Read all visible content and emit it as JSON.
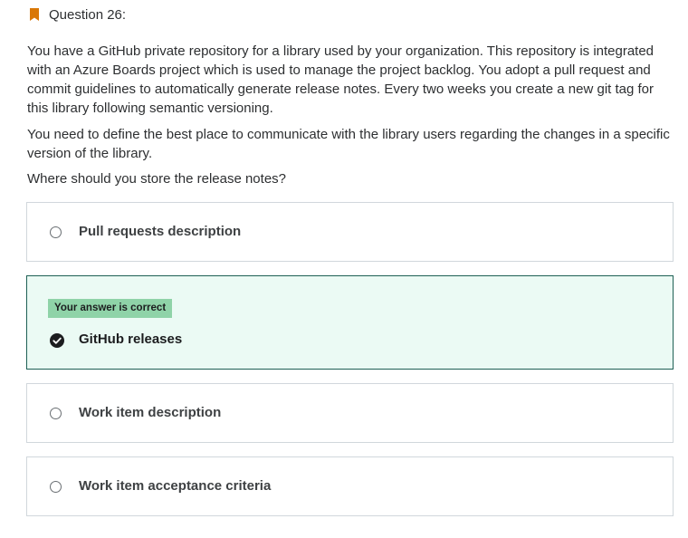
{
  "question": {
    "title": "Question 26:",
    "paragraphs": [
      "You have a GitHub private repository for a library used by your organization. This repository is integrated with an Azure Boards project which is used to manage the project backlog. You adopt a pull request and commit guidelines to automatically generate release notes. Every two weeks you create a new git tag for this library following semantic versioning.",
      "You need to define the best place to communicate with the library users regarding the changes in a specific version of the library.",
      "Where should you store the release notes?"
    ]
  },
  "options": [
    {
      "label": "Pull requests description",
      "selected": false
    },
    {
      "label": "GitHub releases",
      "selected": true,
      "feedback": "Your answer is correct"
    },
    {
      "label": "Work item description",
      "selected": false
    },
    {
      "label": "Work item acceptance criteria",
      "selected": false
    }
  ],
  "colors": {
    "bookmark": "#d97706",
    "correct_border": "#1e6055",
    "correct_background": "#ebfaf4",
    "badge_background": "#8fd3a8"
  }
}
